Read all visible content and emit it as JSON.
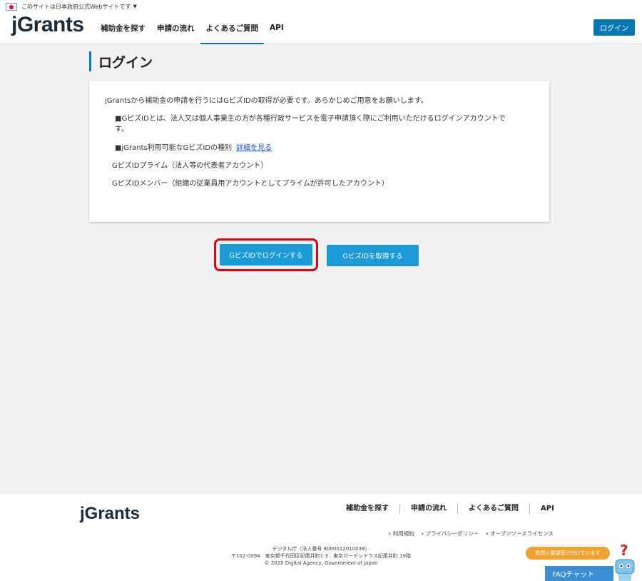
{
  "gov_banner": {
    "text": "このサイトは日本政府公式Webサイトです",
    "caret": "▼"
  },
  "header": {
    "logo": "jGrants",
    "nav": [
      "補助金を探す",
      "申請の流れ",
      "よくあるご質問",
      "API"
    ],
    "active_nav": "よくあるご質問",
    "login_label": "ログイン"
  },
  "main": {
    "title": "ログイン",
    "card": {
      "intro": "jGrantsから補助金の申請を行うにはGビズIDの取得が必要です。あらかじめご用意をお願いします。",
      "about_line1": "■GビズIDとは、法人又は個人事業主の方が各種行政サービスを電子申請頂く際にご利用いただけるログインアカウントで",
      "about_line2": "す。",
      "types_label": "■jGrants利用可能なGビズIDの種別",
      "types_link": "詳細を見る",
      "prime": "GビズIDプライム（法人等の代表者アカウント）",
      "member": "GビズIDメンバー（組織の従業員用アカウントとしてプライムが許可したアカウント）"
    },
    "buttons": {
      "login": "GビズIDでログインする",
      "obtain": "GビズIDを取得する"
    }
  },
  "footer": {
    "logo": "jGrants",
    "nav": [
      "補助金を探す",
      "申請の流れ",
      "よくあるご質問",
      "API"
    ],
    "sub_links": [
      "利用規約",
      "プライバシーポリシー",
      "オープンソースライセンス"
    ],
    "org": "デジタル庁（法人番号 8000012010038）",
    "address": "〒102-0094　東京都千代田区紀尾井町1-3　東京ガーデンテラス紀尾井町 19階",
    "copyright": "© 2020 Digital Agency, Government of Japan"
  },
  "support": {
    "bubble": "質問と要望受け付けています",
    "faq_chat": "FAQチャット"
  },
  "colors": {
    "accent": "#0a77b5",
    "button": "#1a9ad6",
    "highlight": "#e0001b",
    "bubble": "#f0a232"
  }
}
